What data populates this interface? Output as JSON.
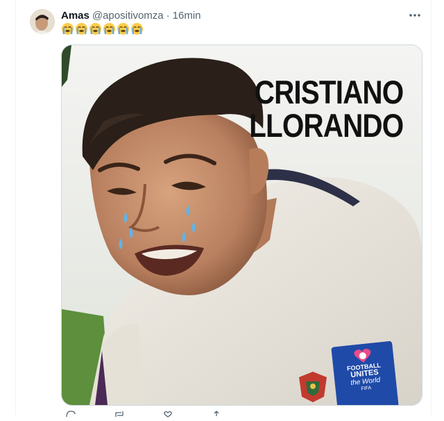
{
  "tweet": {
    "author_name": "Amas",
    "handle": "@apositivomza",
    "separator": "·",
    "time": "16min",
    "emoji_text": "😭😭😭😭😭😭",
    "emoji_count": 6,
    "more_icon": "ellipsis-icon"
  },
  "media": {
    "headline_line1": "CRISTIANO",
    "headline_line2": "LLORANDO",
    "badge_line1": "FOOTBALL",
    "badge_line2": "UNITES",
    "badge_line3": "the World",
    "badge_line4": "FIFA"
  },
  "colors": {
    "text_primary": "#0f1419",
    "text_secondary": "#536471",
    "border": "#cfd9de",
    "badge_blue": "#1f4aa8",
    "tear_blue": "#5fb4e8"
  }
}
